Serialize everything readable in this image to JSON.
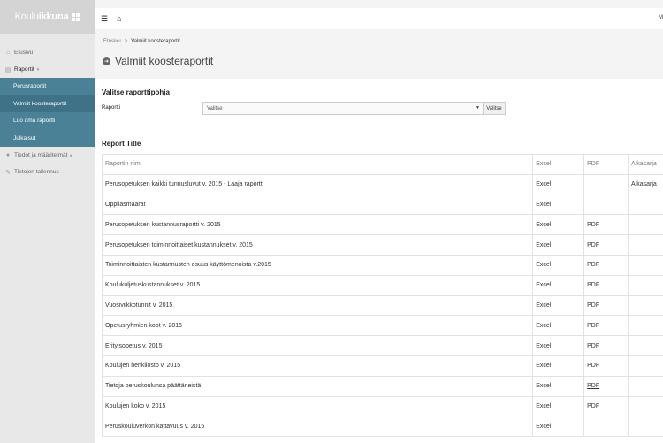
{
  "logo": {
    "light": "Koulu",
    "bold": "ikkuna"
  },
  "sidebar": {
    "items": [
      {
        "label": "Etusivu",
        "icon": "home-icon"
      },
      {
        "label": "Raportit",
        "icon": "report-icon"
      },
      {
        "label": "Tiedot ja määritelmät",
        "icon": "info-icon"
      },
      {
        "label": "Tietojen tallennus",
        "icon": "edit-icon"
      }
    ],
    "submenu": [
      {
        "label": "Perusraportit"
      },
      {
        "label": "Valmiit koosteraportit"
      },
      {
        "label": "Luo oma raportti"
      },
      {
        "label": "Julkaisut"
      }
    ]
  },
  "topbar": {
    "user": "M"
  },
  "breadcrumb": {
    "home": "Etusivu",
    "sep": ">",
    "current": "Valmiit koosteraportit"
  },
  "page": {
    "title": "Valmiit koosteraportit"
  },
  "form": {
    "section_title": "Valitse raporttipohja",
    "label": "Raportti",
    "select_value": "Valitse",
    "button": "Valitse"
  },
  "report": {
    "title": "Report Title",
    "headers": [
      "Raportin nimi",
      "Excel",
      "PDF",
      "Aikasarja"
    ],
    "rows": [
      [
        "Perusopetuksen kaikki tunnusluvut v. 2015 - Laaja raportti",
        "Excel",
        "",
        "Aikasarja"
      ],
      [
        "Oppilasmäärät",
        "Excel",
        "",
        ""
      ],
      [
        "Perusopetuksen kustannusraportti v. 2015",
        "Excel",
        "PDF",
        ""
      ],
      [
        "Perusopetuksen toiminnoittaiset kustannukset v. 2015",
        "Excel",
        "PDF",
        ""
      ],
      [
        "Toiminnoittaisten kustannusten osuus käyttömenoista v.2015",
        "Excel",
        "PDF",
        ""
      ],
      [
        "Koulukuljetuskustannukset v. 2015",
        "Excel",
        "PDF",
        ""
      ],
      [
        "Vuosiviikkotunnit v. 2015",
        "Excel",
        "PDF",
        ""
      ],
      [
        "Opetusryhmien koot v. 2015",
        "Excel",
        "PDF",
        ""
      ],
      [
        "Erityisopetus v. 2015",
        "Excel",
        "PDF",
        ""
      ],
      [
        "Koulujen henkilöstö v. 2015",
        "Excel",
        "PDF",
        ""
      ],
      [
        "Tietoja peruskoulunsa päättäneistä",
        "Excel",
        "PDF",
        ""
      ],
      [
        "Koulujen koko v. 2015",
        "Excel",
        "PDF",
        ""
      ],
      [
        "Peruskouluverkon kattavuus v. 2015",
        "Excel",
        "",
        ""
      ]
    ]
  }
}
